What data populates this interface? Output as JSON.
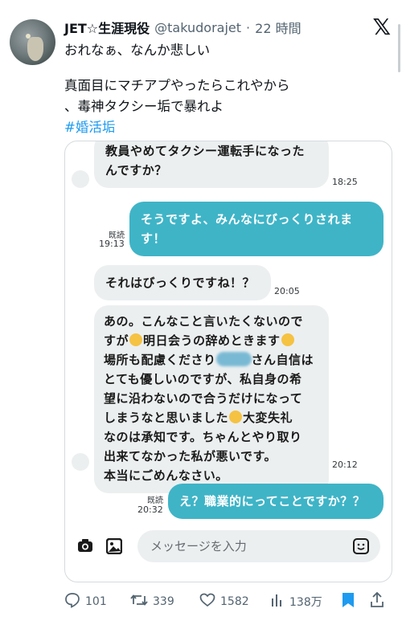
{
  "tweet": {
    "display_name": "JET☆生涯現役",
    "handle": "@takudorajet",
    "separator": "·",
    "time": "22 時間",
    "lines": [
      "おれなぁ、なんか悲しい",
      "真面目にマチアプやったらこれやから",
      "、毒神タクシー垢で暴れよ"
    ],
    "hashtag": "#婚活垢"
  },
  "chat": {
    "messages": [
      {
        "side": "in",
        "lines": [
          "教員やめてタクシー運転手になった",
          "んですか？"
        ],
        "time": "18:25"
      },
      {
        "side": "out",
        "read": "既読",
        "lines": [
          "そうですよ、みんなにびっくりされま",
          "す！"
        ],
        "time": "19:13"
      },
      {
        "side": "in",
        "lines": [
          "それはびっくりですね！？"
        ],
        "time": "20:05"
      },
      {
        "side": "in",
        "lines": [
          "あの。こんなこと言いたくないので",
          "すが",
          "明日会うの辞めときます",
          "場所も配慮くださり",
          "さん自信は",
          "とても優しいのですが、私自身の希",
          "望に沿わないので合うだけになって",
          "しまうなと思いました",
          "大変失礼",
          "なのは承知です。ちゃんとやり取り",
          "出来てなかった私が悪いです。",
          "本当にごめんなさい。"
        ],
        "time": "20:12"
      },
      {
        "side": "out",
        "read": "既読",
        "lines": [
          "え？職業的にってことですか？？"
        ],
        "time": "20:32"
      }
    ],
    "input_placeholder": "メッセージを入力"
  },
  "actions": {
    "replies": "101",
    "reposts": "339",
    "likes": "1582",
    "views": "138万"
  },
  "colors": {
    "bubble_out": "#3fb4c7",
    "bubble_in": "#eceff0",
    "link": "#1d9bf0"
  }
}
